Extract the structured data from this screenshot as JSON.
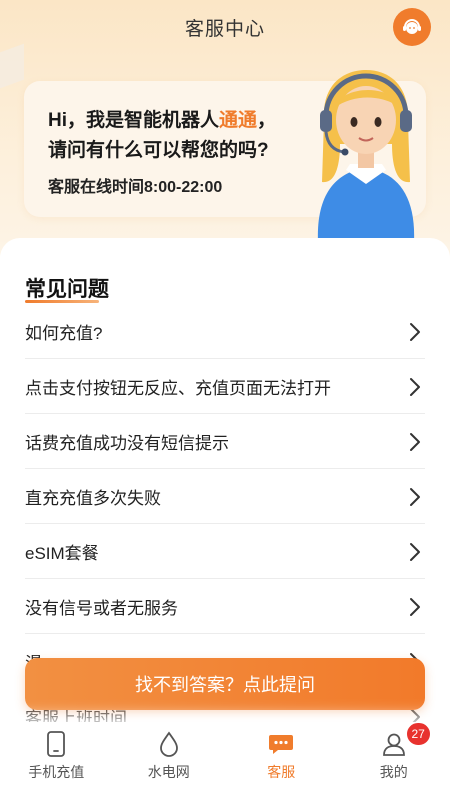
{
  "header": {
    "title": "客服中心"
  },
  "welcome": {
    "greeting_prefix": "Hi，我是智能机器人",
    "bot_name": "通通",
    "greeting_suffix": "，",
    "question": "请问有什么可以帮您的吗?",
    "hours": "客服在线时间8:00-22:00"
  },
  "faq": {
    "title": "常见问题",
    "items": [
      "如何充值?",
      "点击支付按钮无反应、充值页面无法打开",
      "话费充值成功没有短信提示",
      "直充充值多次失败",
      "eSIM套餐",
      "没有信号或者无服务",
      "漫..",
      "客服上班时间"
    ]
  },
  "ask_button": {
    "label": "找不到答案？点此提问"
  },
  "tabbar": {
    "items": [
      {
        "label": "手机充值",
        "icon": "phone-icon",
        "active": false
      },
      {
        "label": "水电网",
        "icon": "water-drop-icon",
        "active": false
      },
      {
        "label": "客服",
        "icon": "chat-icon",
        "active": true
      },
      {
        "label": "我的",
        "icon": "profile-icon",
        "active": false
      }
    ],
    "badge_count": "27"
  },
  "colors": {
    "accent": "#f07c2c",
    "badge": "#e8322e"
  }
}
